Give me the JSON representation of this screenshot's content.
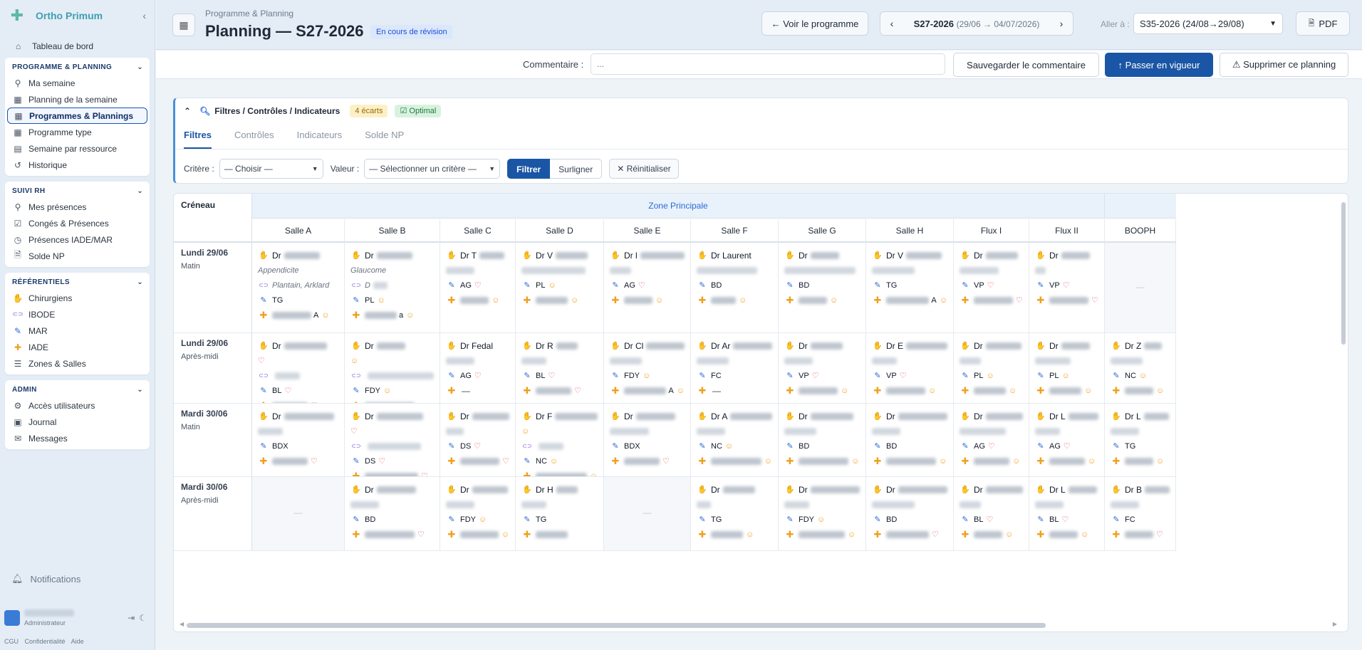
{
  "brand": {
    "name": "Ortho Primum",
    "collapse_icon": "chevron-left-icon"
  },
  "sidebar": {
    "top_item": {
      "label": "Tableau de bord",
      "icon": "home-icon"
    },
    "sections": [
      {
        "title": "PROGRAMME & PLANNING",
        "items": [
          {
            "label": "Ma semaine",
            "icon": "user-clock-icon",
            "active": false
          },
          {
            "label": "Planning de la semaine",
            "icon": "calendar-icon",
            "active": false
          },
          {
            "label": "Programmes & Plannings",
            "icon": "calendar-icon",
            "active": true
          },
          {
            "label": "Programme type",
            "icon": "calendar-icon",
            "active": false
          },
          {
            "label": "Semaine par ressource",
            "icon": "table-icon",
            "active": false
          },
          {
            "label": "Historique",
            "icon": "history-icon",
            "active": false
          }
        ]
      },
      {
        "title": "SUIVI RH",
        "items": [
          {
            "label": "Mes présences",
            "icon": "user-clock-icon"
          },
          {
            "label": "Congés & Présences",
            "icon": "calendar-check-icon"
          },
          {
            "label": "Présences IADE/MAR",
            "icon": "clock-icon"
          },
          {
            "label": "Solde NP",
            "icon": "document-icon"
          }
        ]
      },
      {
        "title": "RÉFÉRENTIELS",
        "items": [
          {
            "label": "Chirurgiens",
            "icon": "hand-icon"
          },
          {
            "label": "IBODE",
            "icon": "capsule-icon"
          },
          {
            "label": "MAR",
            "icon": "syringe-icon"
          },
          {
            "label": "IADE",
            "icon": "cross-icon"
          },
          {
            "label": "Zones & Salles",
            "icon": "list-icon"
          }
        ]
      },
      {
        "title": "ADMIN",
        "items": [
          {
            "label": "Accès utilisateurs",
            "icon": "user-gear-icon"
          },
          {
            "label": "Journal",
            "icon": "journal-icon"
          },
          {
            "label": "Messages",
            "icon": "mail-icon"
          }
        ]
      }
    ],
    "notifications_label": "Notifications",
    "user_role": "Administrateur",
    "legal": [
      "CGU",
      "Confidentialité",
      "Aide"
    ]
  },
  "header": {
    "breadcrumb": "Programme & Planning",
    "title": "Planning — S27-2026",
    "status_badge": "En cours de révision",
    "view_program_label": "← Voir le programme",
    "week_label": "S27-2026",
    "week_range": "(29/06 → 04/07/2026)",
    "goto_label": "Aller à :",
    "goto_value": "S35-2026 (24/08→29/08)",
    "pdf_label": "PDF"
  },
  "comment_bar": {
    "label": "Commentaire :",
    "value": "...",
    "save_label": "Sauvegarder le commentaire",
    "activate_label": "↑ Passer en vigueur",
    "delete_label": "⚠ Supprimer ce planning"
  },
  "filters": {
    "title": "Filtres / Contrôles / Indicateurs",
    "ecarts_badge": "4 écarts",
    "optimal_badge": "Optimal",
    "tabs": [
      "Filtres",
      "Contrôles",
      "Indicateurs",
      "Solde NP"
    ],
    "criterion_label": "Critère :",
    "criterion_value": "— Choisir —",
    "value_label": "Valeur :",
    "value_value": "— Sélectionner un critère —",
    "filter_label": "Filtrer",
    "highlight_label": "Surligner",
    "reset_label": "✕ Réinitialiser"
  },
  "grid": {
    "slot_header": "Créneau",
    "zone_label": "Zone Principale",
    "columns": [
      "Salle A",
      "Salle B",
      "Salle C",
      "Salle D",
      "Salle E",
      "Salle F",
      "Salle G",
      "Salle H",
      "Flux I",
      "Flux II",
      "BOOPH"
    ],
    "rows": [
      {
        "day": "Lundi 29/06",
        "period": "Matin",
        "cells": [
          {
            "dr": "Dr",
            "b": 50,
            "sub": "Appendicite",
            "ib": "Plantain, Arklard",
            "mar": "TG",
            "iade_b": 55,
            "iade_t": "A",
            "iade_s": "smile"
          },
          {
            "dr": "Dr",
            "b": 50,
            "sub": "Glaucome",
            "ib": "D",
            "ibw": 20,
            "mar": "PL",
            "mar_s": "smile",
            "iade_b": 45,
            "iade_t": "a",
            "iade_s": "smile"
          },
          {
            "dr": "Dr T",
            "b": 35,
            "sub": "",
            "subw": 40,
            "ib": "AG",
            "ib_s": "heart",
            "iade_b": 40,
            "iade_s": "smile"
          },
          {
            "dr": "Dr V",
            "b": 45,
            "sub": "",
            "subw": 90,
            "ib": "PL",
            "ib_s": "smile",
            "iade_b": 45,
            "iade_s": "smile"
          },
          {
            "dr": "Dr l",
            "b": 90,
            "sub": "",
            "subw": 30,
            "ib": "AG",
            "ib_s": "heart",
            "iade_b": 40,
            "iade_s": "smile"
          },
          {
            "dr": "Dr Laurent",
            "b": 0,
            "sub": "",
            "subw": 85,
            "ib": "BD",
            "iade_b": 35,
            "iade_s": "smile"
          },
          {
            "dr": "Dr",
            "b": 40,
            "sub": "",
            "subw": 100,
            "ib": "BD",
            "iade_b": 40,
            "iade_s": "smile"
          },
          {
            "dr": "Dr V",
            "b": 50,
            "sub": "",
            "subw": 60,
            "ib": "TG",
            "iade_b": 70,
            "iade_t": "A",
            "iade_s": "smile"
          },
          {
            "dr": "Dr",
            "b": 45,
            "sub": "",
            "subw": 55,
            "ib": "VP",
            "ib_s": "heart",
            "iade_b": 55,
            "iade_s": "heart"
          },
          {
            "dr": "Dr",
            "b": 40,
            "sub": "",
            "subw": 15,
            "ib": "VP",
            "ib_s": "heart",
            "iade_b": 55,
            "iade_s": "heart"
          },
          {
            "empty": true
          }
        ]
      },
      {
        "day": "Lundi 29/06",
        "period": "Après-midi",
        "cells": [
          {
            "dr": "Dr",
            "b": 60,
            "heart_only": true,
            "ib": "",
            "ibw": 35,
            "mar": "BL",
            "mar_s": "heart",
            "iade_b": 50,
            "iade_s": "heart"
          },
          {
            "dr": "Dr",
            "b": 40,
            "smile_only": true,
            "ib": "",
            "ibw": 130,
            "mar": "FDY",
            "mar_s": "smile",
            "iade_b": 70,
            "iade_s": "smile"
          },
          {
            "dr": "Dr Fedal",
            "b": 0,
            "sub": "",
            "subw": 40,
            "ib": "AG",
            "ib_s": "heart",
            "iade_dash": true
          },
          {
            "dr": "Dr R",
            "b": 30,
            "sub": "",
            "subw": 35,
            "ib": "BL",
            "ib_s": "heart",
            "iade_b": 50,
            "iade_s": "heart"
          },
          {
            "dr": "Dr Cl",
            "b": 55,
            "sub": "",
            "subw": 45,
            "ib": "FDY",
            "ib_s": "smile",
            "iade_b": 70,
            "iade_t": "A",
            "iade_s": "smile"
          },
          {
            "dr": "Dr Ar",
            "b": 65,
            "sub": "",
            "subw": 45,
            "ib": "FC",
            "iade_dash": true
          },
          {
            "dr": "Dr",
            "b": 45,
            "sub": "",
            "subw": 40,
            "ib": "VP",
            "ib_s": "heart",
            "iade_b": 55,
            "iade_s": "smile"
          },
          {
            "dr": "Dr E",
            "b": 75,
            "sub": "",
            "subw": 35,
            "ib": "VP",
            "ib_s": "heart",
            "iade_b": 55,
            "iade_s": "smile"
          },
          {
            "dr": "Dr",
            "b": 50,
            "sub": "",
            "subw": 30,
            "ib": "PL",
            "ib_s": "smile",
            "iade_b": 45,
            "iade_s": "smile"
          },
          {
            "dr": "Dr",
            "b": 40,
            "sub": "",
            "subw": 50,
            "ib": "PL",
            "ib_s": "smile",
            "iade_b": 45,
            "iade_s": "smile"
          },
          {
            "dr": "Dr Z",
            "b": 25,
            "sub": "",
            "subw": 45,
            "ib": "NC",
            "ib_s": "smile",
            "iade_b": 40,
            "iade_s": "smile"
          }
        ]
      },
      {
        "day": "Mardi 30/06",
        "period": "Matin",
        "cells": [
          {
            "dr": "Dr",
            "b": 70,
            "sub": "",
            "subw": 35,
            "mar": "BDX",
            "iade_b": 50,
            "iade_s": "heart"
          },
          {
            "dr": "Dr",
            "b": 65,
            "heart_only": true,
            "ib": "",
            "ibw": 75,
            "mar": "DS",
            "mar_s": "heart",
            "iade_b": 75,
            "iade_s": "heart"
          },
          {
            "dr": "Dr",
            "b": 55,
            "sub": "",
            "subw": 25,
            "ib": "DS",
            "ib_s": "heart",
            "iade_b": 65,
            "iade_s": "heart"
          },
          {
            "dr": "Dr F",
            "b": 60,
            "smile_only": true,
            "ib": "",
            "ibw": 35,
            "mar": "NC",
            "mar_s": "smile",
            "iade_b": 110,
            "iade_s": "smile"
          },
          {
            "dr": "Dr",
            "b": 55,
            "sub": "",
            "subw": 55,
            "ib": "BDX",
            "iade_b": 50,
            "iade_s": "heart"
          },
          {
            "dr": "Dr A",
            "b": 65,
            "sub": "",
            "subw": 40,
            "ib": "NC",
            "ib_s": "smile",
            "iade_b": 110,
            "iade_s": "smile"
          },
          {
            "dr": "Dr",
            "b": 60,
            "sub": "",
            "subw": 45,
            "ib": "BD",
            "iade_b": 70,
            "iade_s": "smile"
          },
          {
            "dr": "Dr",
            "b": 70,
            "sub": "",
            "subw": 40,
            "ib": "BD",
            "iade_b": 70,
            "iade_s": "smile"
          },
          {
            "dr": "Dr",
            "b": 65,
            "sub": "",
            "subw": 65,
            "ib": "AG",
            "ib_s": "heart",
            "iade_b": 50,
            "iade_s": "smile"
          },
          {
            "dr": "Dr L",
            "b": 50,
            "sub": "",
            "subw": 35,
            "ib": "AG",
            "ib_s": "heart",
            "iade_b": 50,
            "iade_s": "smile"
          },
          {
            "dr": "Dr L",
            "b": 35,
            "sub": "",
            "subw": 40,
            "ib": "TG",
            "iade_b": 40,
            "iade_s": "smile"
          }
        ]
      },
      {
        "day": "Mardi 30/06",
        "period": "Après-midi",
        "cells": [
          {
            "empty": true
          },
          {
            "dr": "Dr",
            "b": 55,
            "sub": "",
            "subw": 40,
            "ib": "BD",
            "iade_b": 70,
            "iade_s": "heart"
          },
          {
            "dr": "Dr",
            "b": 50,
            "sub": "",
            "subw": 40,
            "ib": "FDY",
            "ib_s": "smile",
            "iade_b": 70,
            "iade_s": "smile"
          },
          {
            "dr": "Dr H",
            "b": 30,
            "sub": "",
            "subw": 35,
            "ib": "TG",
            "iade_b": 45
          },
          {
            "empty": true
          },
          {
            "dr": "Dr",
            "b": 45,
            "sub": "",
            "subw": 20,
            "ib": "TG",
            "iade_b": 45,
            "iade_s": "smile"
          },
          {
            "dr": "Dr",
            "b": 90,
            "sub": "",
            "subw": 35,
            "ib": "FDY",
            "ib_s": "smile",
            "iade_b": 65,
            "iade_s": "smile"
          },
          {
            "dr": "Dr",
            "b": 80,
            "sub": "",
            "subw": 60,
            "ib": "BD",
            "iade_b": 60,
            "iade_s": "heart"
          },
          {
            "dr": "Dr",
            "b": 55,
            "sub": "",
            "subw": 30,
            "ib": "BL",
            "ib_s": "heart",
            "iade_b": 40,
            "iade_s": "smile"
          },
          {
            "dr": "Dr L",
            "b": 40,
            "sub": "",
            "subw": 40,
            "ib": "BL",
            "ib_s": "heart",
            "iade_b": 40,
            "iade_s": "smile"
          },
          {
            "dr": "Dr B",
            "b": 35,
            "sub": "",
            "subw": 40,
            "ib": "FC",
            "iade_b": 40,
            "iade_s": "heart"
          }
        ]
      }
    ]
  }
}
